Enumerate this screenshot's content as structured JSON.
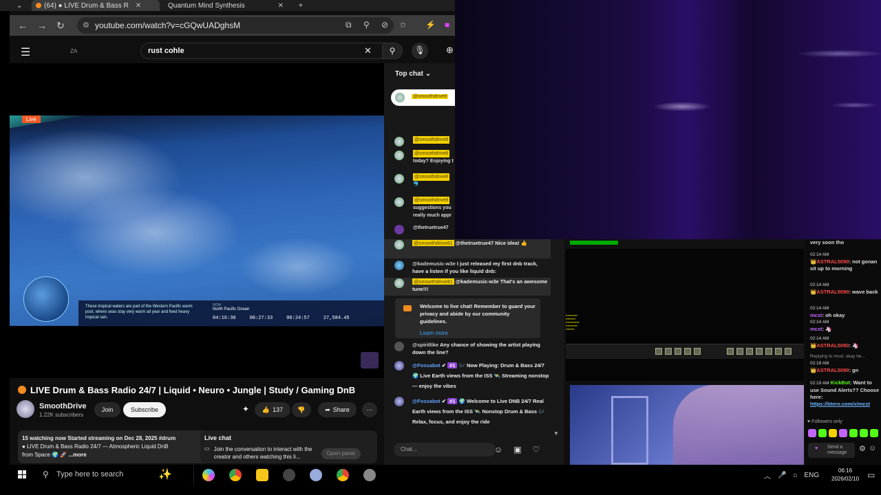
{
  "browser": {
    "tabs": [
      {
        "label": "(64) ● LIVE Drum & Bass R"
      },
      {
        "label": "Quantum Mind Synthesis"
      }
    ],
    "url": "youtube.com/watch?v=cGQwUADghsM"
  },
  "youtube": {
    "logo_text": "ZA",
    "search_value": "rust cohle",
    "video": {
      "live_label": "Live",
      "overlay_desc": "These tropical waters are part of the Western Pacific warm pool, where seas stay very warm all year and feed heavy tropical rain.",
      "overlay_region_label": "NOW",
      "overlay_region": "North Pacific Ocean",
      "times": [
        "04:16:30",
        "00:27:33",
        "00:24:57",
        "27,584.45"
      ]
    },
    "title": "LIVE Drum & Bass Radio 24/7 | Liquid • Neuro • Jungle | Study / Gaming DnB",
    "channel": {
      "name": "SmoothDrive",
      "subs": "1.22K subscribers"
    },
    "buttons": {
      "join": "Join",
      "subscribe": "Subscribe",
      "likes": "137",
      "share": "Share"
    },
    "description": {
      "line1": "15 watching now  Started streaming on Dec 28, 2025  #drum",
      "line2": "LIVE Drum & Bass Radio 24/7 — Atmospheric Liquid DnB",
      "line3": "from Space",
      "more": "...more"
    },
    "livechat_card": {
      "title": "Live chat",
      "text": "Join the conversation to interact with the creator and others watching this li...",
      "button": "Open panel"
    },
    "chat": {
      "header": "Top chat",
      "pinned_name": "@smoothdrive8",
      "upper": [
        {
          "name": "@smoothdrive8",
          "text": ""
        },
        {
          "name": "@smoothdrive8",
          "text": "today? Enjoying t"
        },
        {
          "name": "@smoothdrive8",
          "text": "🐬"
        },
        {
          "name": "@smoothdrive8",
          "text": "suggestions you really much appr"
        }
      ],
      "upper_plain": "@thetruetrue47",
      "messages": [
        {
          "name": "@smoothdrive81",
          "text": "@thetruetrue47 Nice idea! 👍"
        },
        {
          "name": "@kademusic-w3e",
          "text": "I just released my first dnb track, have a listen if you like liquid dnb:"
        },
        {
          "name": "@smoothdrive81",
          "text": "@kademusic-w3e That's an awesome tune!!!"
        }
      ],
      "welcome": "Welcome to live chat! Remember to guard your privacy and abide by our community guidelines.",
      "learn_more": "Learn more",
      "after": [
        {
          "name": "@spiritlike",
          "text": "Any chance of showing the artist playing down the line?"
        },
        {
          "name": "@Fossabot",
          "badge": "#1",
          "text": "🎶 Now Playing: Drum & Bass 24/7 🌍 Live Earth views from the ISS 🛰️ Streaming nonstop — enjoy the vibes"
        },
        {
          "name": "@Fossabot",
          "badge": "#1",
          "text": "🌍 Welcome to Live DNB 24/7 Real Earth views from the ISS 🛰️ Nonstop Drum & Bass 🎶 Relax, focus, and enjoy the ride"
        }
      ],
      "input_placeholder": "Chat..."
    }
  },
  "kick": {
    "messages": [
      {
        "time": "",
        "user": "",
        "text": "very soon tho"
      },
      {
        "time": "02:14 AM",
        "user": "ASTRAL5090",
        "text": ": not gonan sit up to morning"
      },
      {
        "time": "02:14 AM",
        "user": "ASTRAL5090",
        "text": ": wave back"
      },
      {
        "time": "02:14 AM",
        "user": "mcst",
        "text": ": oh okay"
      },
      {
        "time": "02:14 AM",
        "user": "mcst",
        "text": ": 🦄"
      },
      {
        "time": "02:14 AM",
        "user": "ASTRAL5090",
        "text": ": 🦄"
      },
      {
        "time": "02:18 AM",
        "user": "ASTRAL5090",
        "text": ": gn",
        "reply": "Replying to mcst: okay he..."
      },
      {
        "time": "02:19 AM",
        "user": "KickBot",
        "text": ": Want to use Sound Alerts?? Choose here:",
        "link": "https://btero.com/x/mcst"
      }
    ],
    "followers_only": "Followers only",
    "send_placeholder": "Send a message"
  },
  "taskbar": {
    "search_placeholder": "Type here to search",
    "lang": "ENG",
    "time": "06:16",
    "date": "2026/02/10"
  },
  "colors": {
    "yt_bg": "#0f0f0f",
    "accent_orange": "#f28b20",
    "kick_green": "#53fc18",
    "mod_yellow": "#f5d100"
  }
}
